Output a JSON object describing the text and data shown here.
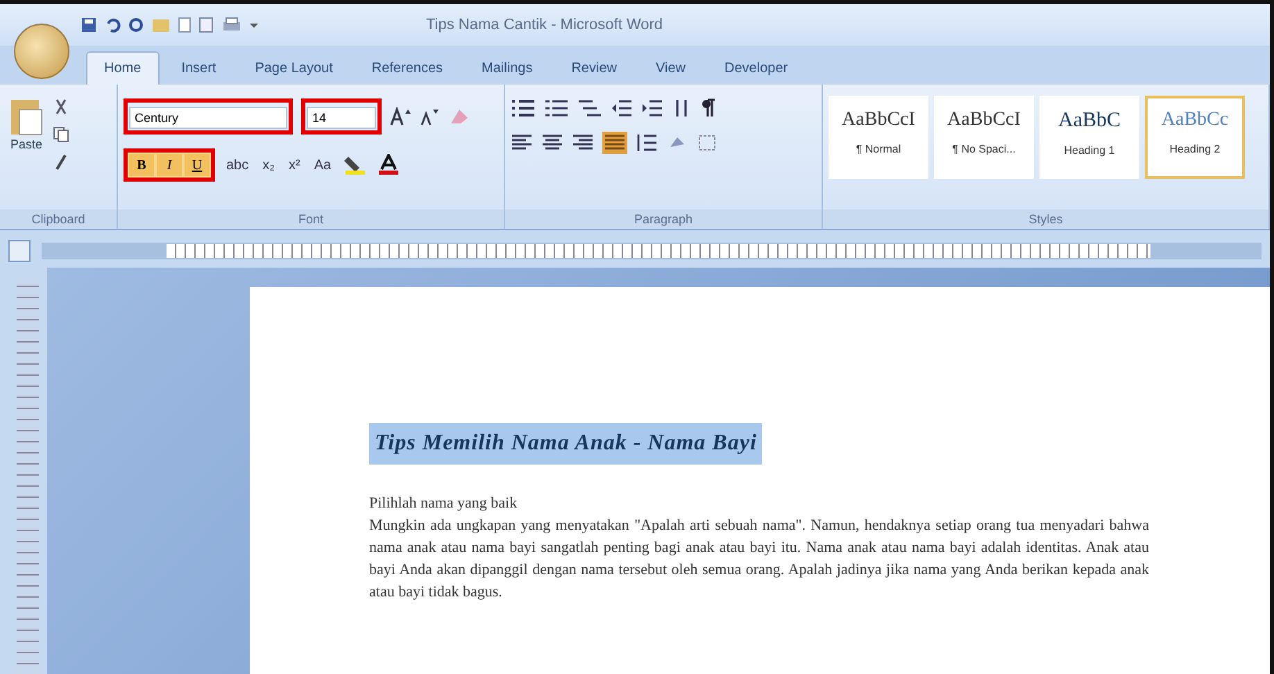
{
  "window": {
    "title": "Tips Nama Cantik - Microsoft Word"
  },
  "tabs": [
    {
      "label": "Home",
      "selected": true
    },
    {
      "label": "Insert",
      "selected": false
    },
    {
      "label": "Page Layout",
      "selected": false
    },
    {
      "label": "References",
      "selected": false
    },
    {
      "label": "Mailings",
      "selected": false
    },
    {
      "label": "Review",
      "selected": false
    },
    {
      "label": "View",
      "selected": false
    },
    {
      "label": "Developer",
      "selected": false
    }
  ],
  "clipboard": {
    "paste": "Paste",
    "group": "Clipboard"
  },
  "font": {
    "name": {
      "value": "Century",
      "highlighted": true
    },
    "size": {
      "value": "14",
      "highlighted": true
    },
    "format_highlighted": true,
    "format_buttons": [
      {
        "label": "B",
        "kind": "bold"
      },
      {
        "label": "I",
        "kind": "italic"
      },
      {
        "label": "U",
        "kind": "underline"
      }
    ],
    "effect_buttons": [
      "abc",
      "x₂",
      "x²",
      "Aa"
    ],
    "group": "Font"
  },
  "paragraph": {
    "group": "Paragraph"
  },
  "styles": {
    "group": "Styles",
    "items": [
      {
        "sample": "AaBbCcI",
        "name": "¶ Normal",
        "kind": "body",
        "selected": false
      },
      {
        "sample": "AaBbCcI",
        "name": "¶ No Spaci...",
        "kind": "body",
        "selected": false
      },
      {
        "sample": "AaBbC",
        "name": "Heading 1",
        "kind": "heading1",
        "selected": false
      },
      {
        "sample": "AaBbCc",
        "name": "Heading 2",
        "kind": "heading2",
        "selected": true
      }
    ]
  },
  "document": {
    "heading": "Tips Memilih Nama Anak - Nama Bayi",
    "heading_selected": true,
    "paragraphs": [
      "Pilihlah nama yang baik",
      "Mungkin ada ungkapan yang menyatakan \"Apalah arti sebuah nama\". Namun, hendaknya setiap orang tua menyadari bahwa nama anak atau nama bayi sangatlah penting bagi anak atau bayi itu. Nama anak atau nama bayi adalah identitas. Anak atau bayi Anda akan dipanggil dengan nama tersebut oleh semua orang. Apalah jadinya jika nama yang Anda berikan kepada anak atau bayi tidak bagus."
    ]
  }
}
